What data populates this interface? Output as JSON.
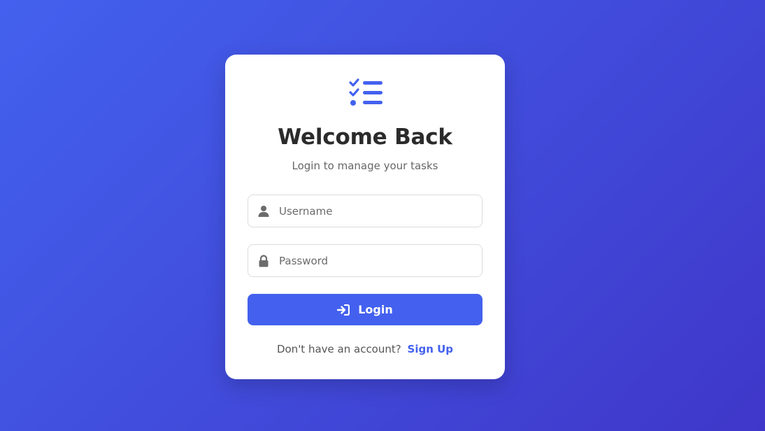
{
  "colors": {
    "primary": "#4361ee",
    "background_start": "#4361ee",
    "background_end": "#3f37c9",
    "title": "#2b2b2b",
    "muted": "#666666"
  },
  "logo": {
    "icon": "list-check-icon"
  },
  "title": "Welcome Back",
  "subtitle": "Login to manage your tasks",
  "username": {
    "icon": "user-icon",
    "placeholder": "Username",
    "value": ""
  },
  "password": {
    "icon": "lock-icon",
    "placeholder": "Password",
    "value": ""
  },
  "login_button": {
    "icon": "sign-in-icon",
    "label": "Login"
  },
  "footer": {
    "text": "Don't have an account?",
    "link": "Sign Up"
  }
}
